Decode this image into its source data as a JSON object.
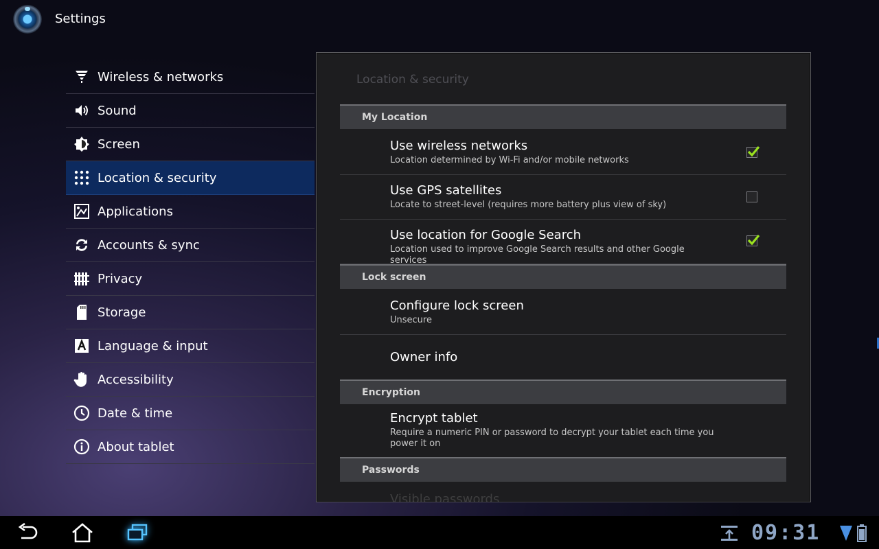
{
  "app": {
    "title": "Settings"
  },
  "sidebar": {
    "items": [
      {
        "label": "Wireless & networks",
        "icon": "wifi-icon"
      },
      {
        "label": "Sound",
        "icon": "speaker-icon"
      },
      {
        "label": "Screen",
        "icon": "brightness-icon"
      },
      {
        "label": "Location & security",
        "icon": "lock-pattern-icon",
        "selected": true
      },
      {
        "label": "Applications",
        "icon": "applications-icon"
      },
      {
        "label": "Accounts & sync",
        "icon": "sync-icon"
      },
      {
        "label": "Privacy",
        "icon": "privacy-fence-icon"
      },
      {
        "label": "Storage",
        "icon": "sdcard-icon"
      },
      {
        "label": "Language & input",
        "icon": "language-icon"
      },
      {
        "label": "Accessibility",
        "icon": "hand-icon"
      },
      {
        "label": "Date & time",
        "icon": "clock-icon"
      },
      {
        "label": "About tablet",
        "icon": "info-icon"
      }
    ]
  },
  "panel": {
    "title": "Location & security",
    "categories": {
      "my_location": "My Location",
      "lock_screen": "Lock screen",
      "encryption": "Encryption",
      "passwords": "Passwords"
    },
    "prefs": {
      "wireless": {
        "title": "Use wireless networks",
        "summary": "Location determined by Wi-Fi and/or mobile networks",
        "checked": true
      },
      "gps": {
        "title": "Use GPS satellites",
        "summary": "Locate to street-level (requires more battery plus view of sky)",
        "checked": false
      },
      "google_search": {
        "title": "Use location for Google Search",
        "summary": "Location used to improve Google Search results and other Google services",
        "checked": true
      },
      "configure_lock": {
        "title": "Configure lock screen",
        "summary": "Unsecure"
      },
      "owner_info": {
        "title": "Owner info"
      },
      "encrypt": {
        "title": "Encrypt tablet",
        "summary": "Require a numeric PIN or password to decrypt your tablet each time you power it on"
      },
      "visible_passwords": {
        "title": "Visible passwords"
      }
    }
  },
  "statusbar": {
    "time": "09:31",
    "icons": [
      "download-icon",
      "signal-icon",
      "battery-icon"
    ]
  },
  "navbar": {
    "buttons": [
      "back-icon",
      "home-icon",
      "recent-apps-icon"
    ]
  },
  "colors": {
    "selected_bg": "#0d2a5e",
    "check": "#9be21f",
    "clock": "#8fa6c6"
  }
}
